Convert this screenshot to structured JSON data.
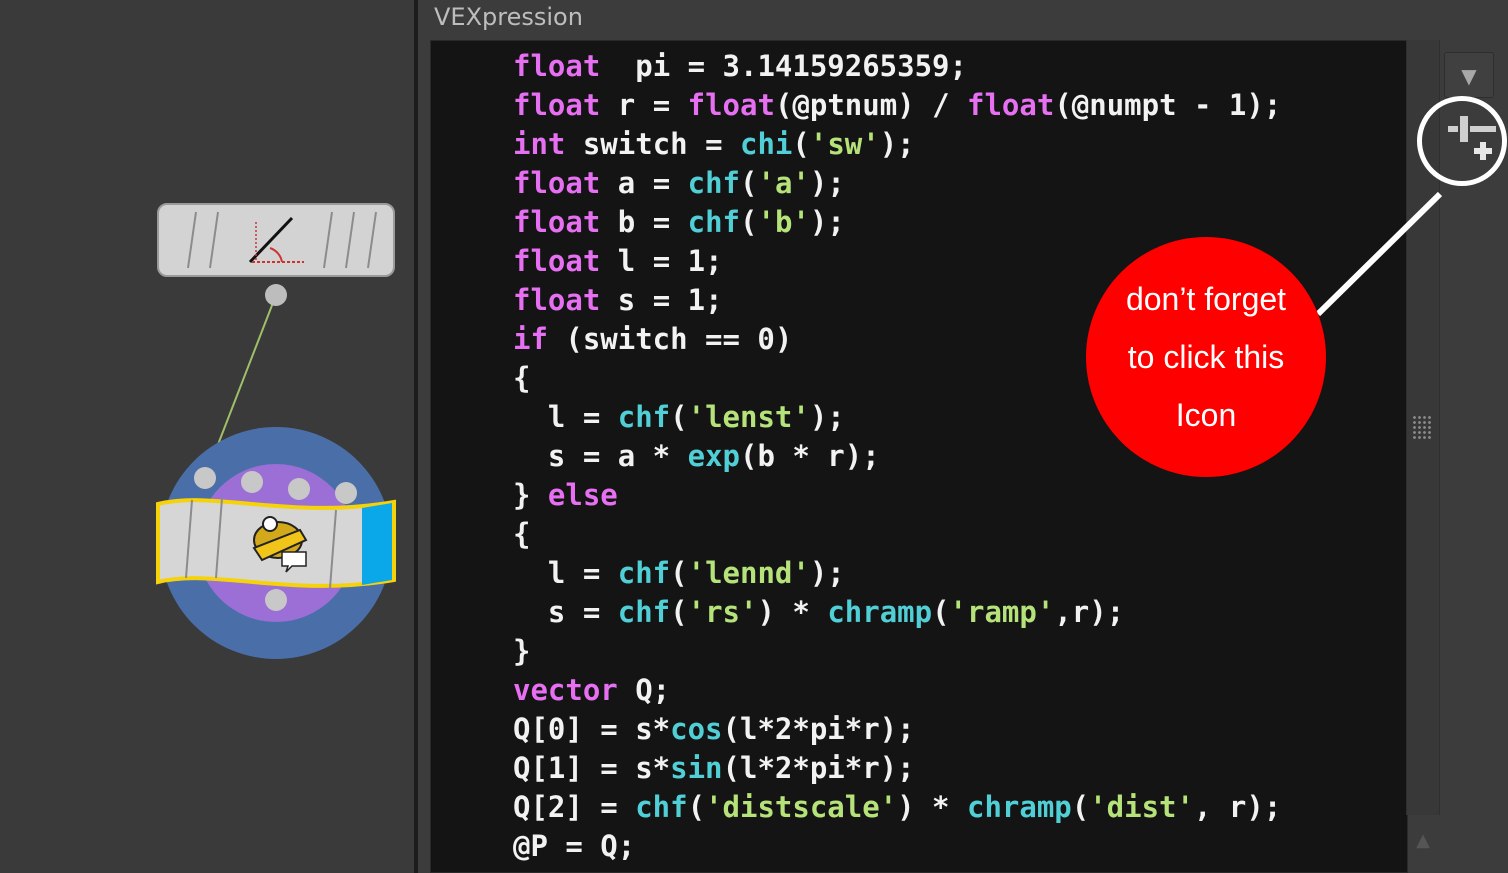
{
  "panel": {
    "title": "VEXpression",
    "dropdown_icon": "▼",
    "scroll_up_icon": "▲"
  },
  "code_lines": [
    [
      {
        "t": "float",
        "c": "kw"
      },
      {
        "t": "  pi = 3.14159265359;",
        "c": ""
      }
    ],
    [
      {
        "t": "float",
        "c": "kw"
      },
      {
        "t": " r = ",
        "c": ""
      },
      {
        "t": "float",
        "c": "kw"
      },
      {
        "t": "(@ptnum) / ",
        "c": ""
      },
      {
        "t": "float",
        "c": "kw"
      },
      {
        "t": "(@numpt - 1);",
        "c": ""
      }
    ],
    [
      {
        "t": "int",
        "c": "kw"
      },
      {
        "t": " switch = ",
        "c": ""
      },
      {
        "t": "chi",
        "c": "fn"
      },
      {
        "t": "(",
        "c": ""
      },
      {
        "t": "'sw'",
        "c": "str"
      },
      {
        "t": ");",
        "c": ""
      }
    ],
    [
      {
        "t": "float",
        "c": "kw"
      },
      {
        "t": " a = ",
        "c": ""
      },
      {
        "t": "chf",
        "c": "fn"
      },
      {
        "t": "(",
        "c": ""
      },
      {
        "t": "'a'",
        "c": "str"
      },
      {
        "t": ");",
        "c": ""
      }
    ],
    [
      {
        "t": "float",
        "c": "kw"
      },
      {
        "t": " b = ",
        "c": ""
      },
      {
        "t": "chf",
        "c": "fn"
      },
      {
        "t": "(",
        "c": ""
      },
      {
        "t": "'b'",
        "c": "str"
      },
      {
        "t": ");",
        "c": ""
      }
    ],
    [
      {
        "t": "float",
        "c": "kw"
      },
      {
        "t": " l = 1;",
        "c": ""
      }
    ],
    [
      {
        "t": "float",
        "c": "kw"
      },
      {
        "t": " s = 1;",
        "c": ""
      }
    ],
    [
      {
        "t": "if",
        "c": "kw"
      },
      {
        "t": " (switch == 0)",
        "c": ""
      }
    ],
    [
      {
        "t": "{",
        "c": ""
      }
    ],
    [
      {
        "t": "  l = ",
        "c": ""
      },
      {
        "t": "chf",
        "c": "fn"
      },
      {
        "t": "(",
        "c": ""
      },
      {
        "t": "'lenst'",
        "c": "str"
      },
      {
        "t": ");",
        "c": ""
      }
    ],
    [
      {
        "t": "  s = a * ",
        "c": ""
      },
      {
        "t": "exp",
        "c": "fn"
      },
      {
        "t": "(b * r);",
        "c": ""
      }
    ],
    [
      {
        "t": "} ",
        "c": ""
      },
      {
        "t": "else",
        "c": "kw"
      }
    ],
    [
      {
        "t": "{",
        "c": ""
      }
    ],
    [
      {
        "t": "  l = ",
        "c": ""
      },
      {
        "t": "chf",
        "c": "fn"
      },
      {
        "t": "(",
        "c": ""
      },
      {
        "t": "'lennd'",
        "c": "str"
      },
      {
        "t": ");",
        "c": ""
      }
    ],
    [
      {
        "t": "  s = ",
        "c": ""
      },
      {
        "t": "chf",
        "c": "fn"
      },
      {
        "t": "(",
        "c": ""
      },
      {
        "t": "'rs'",
        "c": "str"
      },
      {
        "t": ") * ",
        "c": ""
      },
      {
        "t": "chramp",
        "c": "fn"
      },
      {
        "t": "(",
        "c": ""
      },
      {
        "t": "'ramp'",
        "c": "str"
      },
      {
        "t": ",r);",
        "c": ""
      }
    ],
    [
      {
        "t": "}",
        "c": ""
      }
    ],
    [
      {
        "t": "vector",
        "c": "kw"
      },
      {
        "t": " Q;",
        "c": ""
      }
    ],
    [
      {
        "t": "Q[0] = s*",
        "c": ""
      },
      {
        "t": "cos",
        "c": "fn"
      },
      {
        "t": "(l*2*pi*r);",
        "c": ""
      }
    ],
    [
      {
        "t": "Q[1] = s*",
        "c": ""
      },
      {
        "t": "sin",
        "c": "fn"
      },
      {
        "t": "(l*2*pi*r);",
        "c": ""
      }
    ],
    [
      {
        "t": "Q[2] = ",
        "c": ""
      },
      {
        "t": "chf",
        "c": "fn"
      },
      {
        "t": "(",
        "c": ""
      },
      {
        "t": "'distscale'",
        "c": "str"
      },
      {
        "t": ") * ",
        "c": ""
      },
      {
        "t": "chramp",
        "c": "fn"
      },
      {
        "t": "(",
        "c": ""
      },
      {
        "t": "'dist'",
        "c": "str"
      },
      {
        "t": ", r);",
        "c": ""
      }
    ],
    [
      {
        "t": "@P = Q;",
        "c": ""
      }
    ]
  ],
  "callout": {
    "line1": "don’t forget",
    "line2": "to click this",
    "line3": "Icon",
    "color": "#ff0000"
  },
  "icons": {
    "add_parameter": "add-spare-parameters-icon",
    "line_node": "line-node-icon",
    "wrangle_node": "point-wrangle-node-icon"
  },
  "colors": {
    "keyword": "#e66ff2",
    "function": "#50cfd6",
    "string": "#b6e27a",
    "node_selected_outline": "#f5d20a",
    "node_ring_outer": "#4a6fa8",
    "node_ring_inner": "#9b6fd6"
  }
}
